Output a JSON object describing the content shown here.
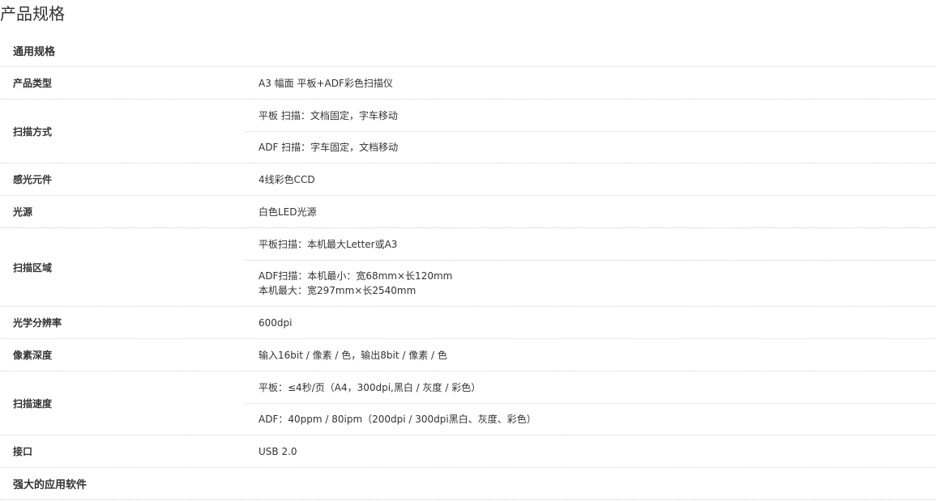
{
  "page": {
    "title": "产品规格"
  },
  "sections": {
    "general": "通用规格",
    "software": "强大的应用软件"
  },
  "specs": [
    {
      "label": "产品类型",
      "values": [
        "A3 幅面 平板+ADF彩色扫描仪"
      ]
    },
    {
      "label": "扫描方式",
      "values": [
        "平板 扫描：文档固定，字车移动",
        "ADF 扫描：字车固定，文档移动"
      ]
    },
    {
      "label": "感光元件",
      "values": [
        "4线彩色CCD"
      ]
    },
    {
      "label": "光源",
      "values": [
        "白色LED光源"
      ]
    },
    {
      "label": "扫描区域",
      "values": [
        "平板扫描：本机最大Letter或A3"
      ],
      "multi": [
        "ADF扫描：本机最小：宽68mm×长120mm",
        "本机最大：宽297mm×长2540mm"
      ]
    },
    {
      "label": "光学分辨率",
      "values": [
        "600dpi"
      ]
    },
    {
      "label": "像素深度",
      "values": [
        "输入16bit / 像素 / 色，输出8bit / 像素 / 色"
      ]
    },
    {
      "label": "扫描速度",
      "values": [
        "平板：≤4秒/页（A4，300dpi,黑白 / 灰度 / 彩色）",
        "ADF：40ppm / 80ipm（200dpi / 300dpi黑白、灰度、彩色）"
      ]
    },
    {
      "label": "接口",
      "values": [
        "USB 2.0"
      ]
    }
  ]
}
